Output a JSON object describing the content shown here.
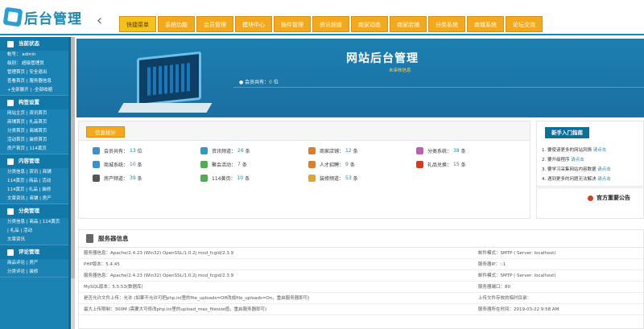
{
  "logo": {
    "text": "后台管理"
  },
  "nav": {
    "tabs": [
      "快捷菜单",
      "系统功能",
      "会员管理",
      "模块中心",
      "插件管理",
      "资讯频道",
      "商家动态",
      "商家店铺",
      "分类系统",
      "商城系统",
      "论坛交流"
    ]
  },
  "sidebar": {
    "groups": [
      {
        "title": "当前状态",
        "rows": [
          "帐号： admin",
          "级别： 超级管理员",
          "管理首页 | 安全退出",
          "查看首页 | 服务器信息",
          "+全部展开 | -全部收缩"
        ]
      },
      {
        "title": "构签设置",
        "rows": [
          "网站主页 | 资讯首页",
          "商铺首页 | 礼品首页",
          "分类首页 | 商城首页",
          "活动首页 | 装修首页",
          "房产首页 | 114黄页"
        ]
      },
      {
        "title": "内容管理",
        "rows": [
          "分类信息 | 资讯 | 商铺",
          "114黄页 | 商品 | 活动",
          "114黄页 | 礼品 | 装修",
          "文章资讯 | 商铺 | 房产"
        ]
      },
      {
        "title": "分类管理",
        "rows": [
          "分类信息 | 商品 | 114黄页",
          "| 礼品 | 活动",
          "文章资讯"
        ]
      },
      {
        "title": "评论管理",
        "rows": [
          "商品评论 | 房产",
          "分类评论 | 装修"
        ]
      }
    ]
  },
  "banner": {
    "title": "网站后台管理",
    "subtitle": "未审核信息",
    "member_label": "会员共有：",
    "member_value": "0",
    "member_unit": "位"
  },
  "info": {
    "section_label": "信息统计",
    "stats": [
      {
        "label": "会员共有：",
        "value": "13",
        "unit": "位",
        "color": "#3a8fd0"
      },
      {
        "label": "资讯频道：",
        "value": "26",
        "unit": "条",
        "color": "#2a9bc8"
      },
      {
        "label": "商家店铺：",
        "value": "12",
        "unit": "条",
        "color": "#e07b2a"
      },
      {
        "label": "分类系统：",
        "value": "38",
        "unit": "条",
        "color": "#c45ab3"
      },
      {
        "label": "商城系统：",
        "value": "10",
        "unit": "条",
        "color": "#3a8fd0"
      },
      {
        "label": "聚会活动：",
        "value": "7",
        "unit": "条",
        "color": "#4caf50"
      },
      {
        "label": "人才招聘：",
        "value": "9",
        "unit": "条",
        "color": "#e07b2a"
      },
      {
        "label": "礼品兑换：",
        "value": "15",
        "unit": "条",
        "color": "#d83b1c"
      },
      {
        "label": "房产频道：",
        "value": "39",
        "unit": "条",
        "color": "#555555"
      },
      {
        "label": "114黄页：",
        "value": "10",
        "unit": "条",
        "color": "#4caf50"
      },
      {
        "label": "装修频道：",
        "value": "53",
        "unit": "条",
        "color": "#e0a52a"
      }
    ]
  },
  "help": {
    "title": "新手入门指南",
    "items": [
      {
        "text": "1. 要使请更多的网站风情 ",
        "link": "请点击"
      },
      {
        "text": "2. 要升级程序 ",
        "link": "请点击"
      },
      {
        "text": "3. 要学习采集网站内容数据 ",
        "link": "请点击"
      },
      {
        "text": "4. 遇到更多的问题无法解决 ",
        "link": "请点击"
      }
    ]
  },
  "notice": {
    "title": "官方重要公告"
  },
  "server": {
    "title": "服务器信息",
    "rows": [
      {
        "left": "服务器信息：Apache/2.4.23 (Win32) OpenSSL/1.0.2j mod_fcgid/2.3.9",
        "right": "邮件模式：SMTP ( Server: localhost)"
      },
      {
        "left": "PHP版本：5.4.45",
        "right": "服务器IP：::1"
      },
      {
        "left": "服务器信息：Apache/2.4.23 (Win32) OpenSSL/1.0.2j mod_fcgid/2.3.9",
        "right": "邮件模式：SMTP ( Server: localhost)"
      },
      {
        "left": "MySQL版本：5.5.53(数据库)",
        "right": "服务器端口：80"
      },
      {
        "left": "是否允许文件上传：允许 (如果不允许可把php.ini里的file_uploads=Off改成file_uploads=On，重启服务器即可)",
        "right": "上传文件存放的临时目录："
      },
      {
        "left": "最大上传限制：300M (需要大可修改php.ini里的upload_max_filesize值，重启服务器即可)",
        "right": "服务器所在时间：2019-03-22 9:58 AM"
      }
    ]
  }
}
